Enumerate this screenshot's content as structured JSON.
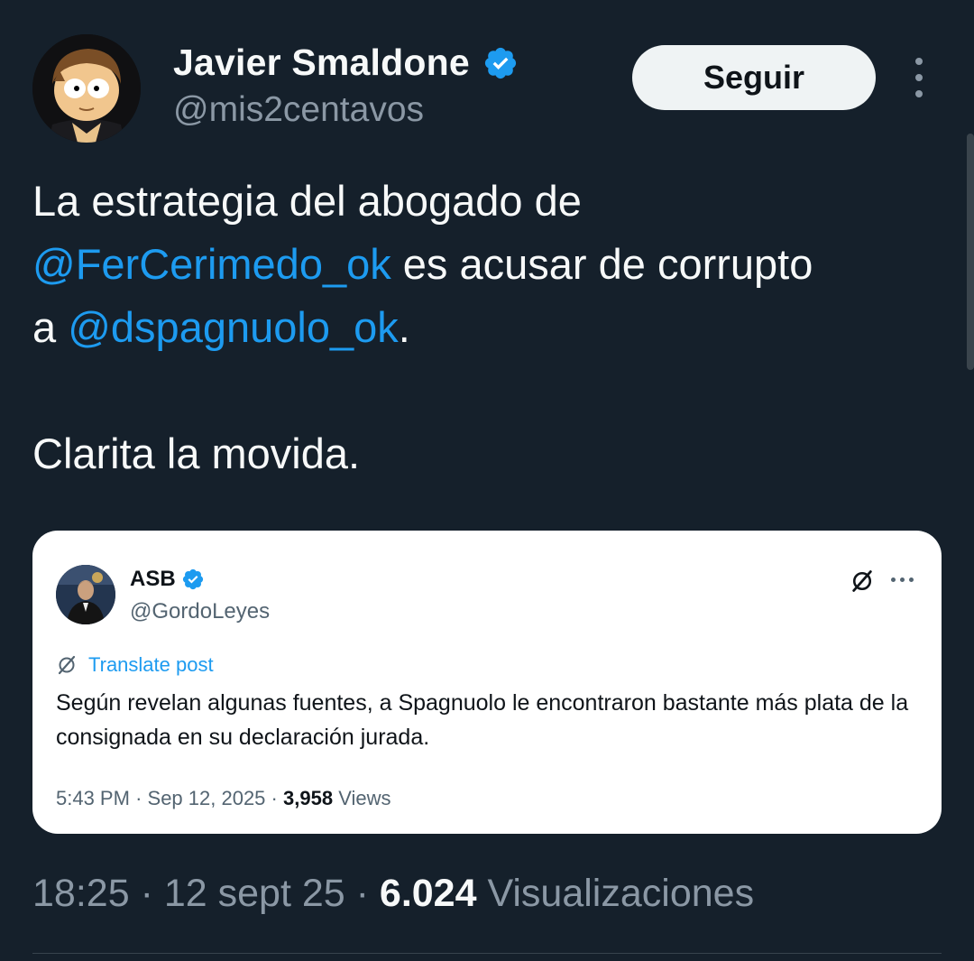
{
  "author": {
    "name": "Javier Smaldone",
    "handle": "@mis2centavos",
    "verified_color": "#1d9bf0"
  },
  "actions": {
    "follow_label": "Seguir",
    "more_icon": "more-vertical-icon"
  },
  "tweet": {
    "line1": "La estrategia del abogado de",
    "mention1": "@FerCerimedo_ok",
    "line2_rest": " es acusar de corrupto",
    "line3_prefix": "a ",
    "mention2": "@dspagnuolo_ok",
    "line3_suffix": ".",
    "line4": "Clarita la movida."
  },
  "quoted": {
    "name": "ASB",
    "handle": "@GordoLeyes",
    "translate_label": "Translate post",
    "text": "Según revelan algunas fuentes, a Spagnuolo le encontraron bastante más plata de la consignada en su declaración jurada.",
    "time": "5:43 PM",
    "date": "Sep 12, 2025",
    "views_count": "3,958",
    "views_label": "Views"
  },
  "meta": {
    "time": "18:25",
    "date": "12 sept 25",
    "views_count": "6.024",
    "views_label": "Visualizaciones"
  },
  "colors": {
    "background": "#15202b",
    "accent": "#1d9bf0",
    "secondary_text": "#8b98a5"
  }
}
